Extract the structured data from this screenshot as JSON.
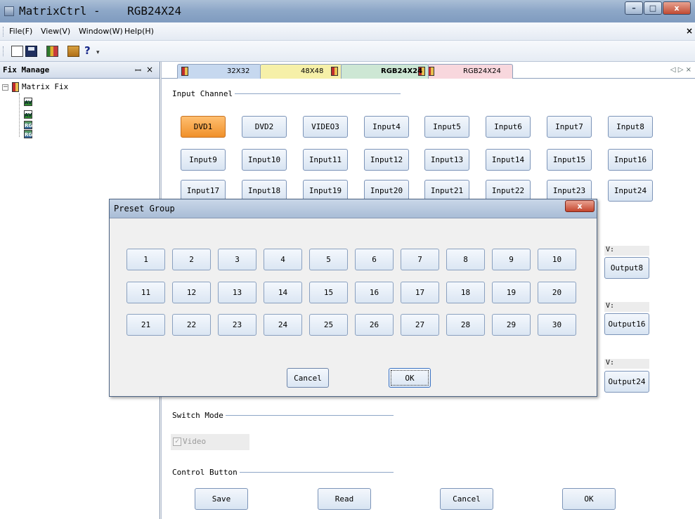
{
  "window": {
    "title_app": "MatrixCtrl -",
    "title_doc": "RGB24X24",
    "controls": {
      "minimize": "–",
      "maximize": "□",
      "close": "x"
    }
  },
  "menu": {
    "items": [
      "File(F)",
      "View(V)",
      "Window(W)",
      "Help(H)"
    ],
    "close_glyph": "×"
  },
  "toolbar": {
    "tools": [
      "new-file-icon",
      "save-icon",
      "matrix-icon",
      "list-icon",
      "help-icon"
    ],
    "help_glyph": "?",
    "more_glyph": "▾"
  },
  "side_panel": {
    "title": "Fix Manage",
    "pin_glyph": "ꟷ",
    "close_glyph": "×",
    "tree": {
      "toggle": "−",
      "root": "Matrix Fix",
      "children": [
        {
          "type": "AV",
          "icon": "av-device-icon"
        },
        {
          "type": "AV",
          "icon": "av-device-icon"
        },
        {
          "type": "RGB",
          "icon": "rgb-device-icon"
        },
        {
          "type": "RGB",
          "icon": "rgb-device-icon"
        }
      ]
    }
  },
  "tabs": [
    {
      "label": "32X32"
    },
    {
      "label": "48X48"
    },
    {
      "label": "RGB24X24",
      "active": true
    },
    {
      "label": "RGB24X24"
    }
  ],
  "tab_nav": "◁ ▷ ×",
  "input_channel": {
    "label": "Input Channel",
    "selected": "DVD1",
    "buttons": [
      "DVD1",
      "DVD2",
      "VIDEO3",
      "Input4",
      "Input5",
      "Input6",
      "Input7",
      "Input8",
      "Input9",
      "Input10",
      "Input11",
      "Input12",
      "Input13",
      "Input14",
      "Input15",
      "Input16",
      "Input17",
      "Input18",
      "Input19",
      "Input20",
      "Input21",
      "Input22",
      "Input23",
      "Input24"
    ]
  },
  "output_channel": {
    "visible": [
      {
        "v_label": "V:",
        "button": "Output8"
      },
      {
        "v_label": "V:",
        "button": "Output16"
      },
      {
        "v_label": "V:",
        "button": "Output24"
      }
    ]
  },
  "switch_mode": {
    "label": "Switch Mode",
    "video_checkbox": {
      "label": "Video",
      "checked": true,
      "enabled": false,
      "glyph": "✓"
    }
  },
  "control_button": {
    "label": "Control Button",
    "buttons": [
      "Save",
      "Read",
      "Cancel",
      "OK"
    ]
  },
  "preset_dialog": {
    "title": "Preset Group",
    "close_glyph": "x",
    "groups": [
      "1",
      "2",
      "3",
      "4",
      "5",
      "6",
      "7",
      "8",
      "9",
      "10",
      "11",
      "12",
      "13",
      "14",
      "15",
      "16",
      "17",
      "18",
      "19",
      "20",
      "21",
      "22",
      "23",
      "24",
      "25",
      "26",
      "27",
      "28",
      "29",
      "30"
    ],
    "cancel_label": "Cancel",
    "ok_label": "OK"
  }
}
